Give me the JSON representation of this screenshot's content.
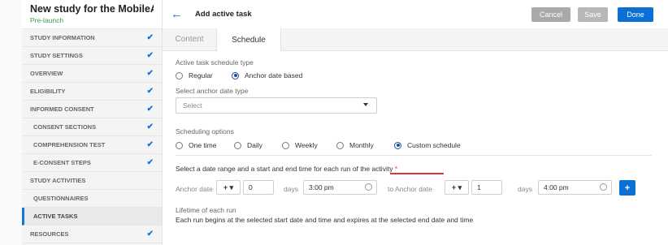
{
  "sidebar": {
    "study_title": "New study for the MobileA...",
    "study_status": "Pre-launch",
    "items": [
      {
        "label": "STUDY INFORMATION",
        "check": "✔",
        "level": "top"
      },
      {
        "label": "STUDY SETTINGS",
        "check": "✔",
        "level": "top"
      },
      {
        "label": "OVERVIEW",
        "check": "✔",
        "level": "top"
      },
      {
        "label": "ELIGIBILITY",
        "check": "✔",
        "level": "top"
      },
      {
        "label": "INFORMED CONSENT",
        "check": "✔",
        "level": "top"
      },
      {
        "label": "CONSENT SECTIONS",
        "check": "✔",
        "level": "sub"
      },
      {
        "label": "COMPREHENSION TEST",
        "check": "✔",
        "level": "sub"
      },
      {
        "label": "E-CONSENT STEPS",
        "check": "✔",
        "level": "sub"
      },
      {
        "label": "STUDY ACTIVITIES",
        "check": "",
        "level": "top"
      },
      {
        "label": "QUESTIONNAIRES",
        "check": "",
        "level": "sub"
      },
      {
        "label": "ACTIVE TASKS",
        "check": "",
        "level": "sub",
        "active": true
      },
      {
        "label": "RESOURCES",
        "check": "✔",
        "level": "top"
      }
    ]
  },
  "header": {
    "back_icon": "←",
    "title": "Add active task",
    "cancel_label": "Cancel",
    "save_label": "Save",
    "done_label": "Done"
  },
  "tabs": {
    "content": "Content",
    "schedule": "Schedule"
  },
  "schedule": {
    "type_label": "Active task schedule type",
    "type_options": [
      "Regular",
      "Anchor date based"
    ],
    "type_selected": "Anchor date based",
    "anchor_type_label": "Select anchor date type",
    "anchor_select_value": "Select",
    "scheduling_label": "Scheduling options",
    "scheduling_options": [
      "One time",
      "Daily",
      "Weekly",
      "Monthly",
      "Custom schedule"
    ],
    "scheduling_selected": "Custom schedule",
    "range_label": "Select a date range and a start and end time for each run of the activity",
    "required_mark": "*",
    "row": {
      "anchor_label_1": "Anchor date",
      "sign_1": "+ ▾",
      "days_value_1": "0",
      "days_label_1": "days",
      "time_value_1": "3:00 pm",
      "anchor_label_2": "to Anchor date",
      "sign_2": "+ ▾",
      "days_value_2": "1",
      "days_label_2": "days",
      "time_value_2": "4:00 pm",
      "add_label": "+"
    },
    "lifetime_label": "Lifetime of each run",
    "lifetime_text": "Each run begins at the selected start date and time and expires at the selected end date and time"
  },
  "colors": {
    "accent": "#0b6fd6",
    "status_green": "#3a9a4b",
    "required_red": "#d9363e",
    "check_blue": "#1a73d8"
  }
}
